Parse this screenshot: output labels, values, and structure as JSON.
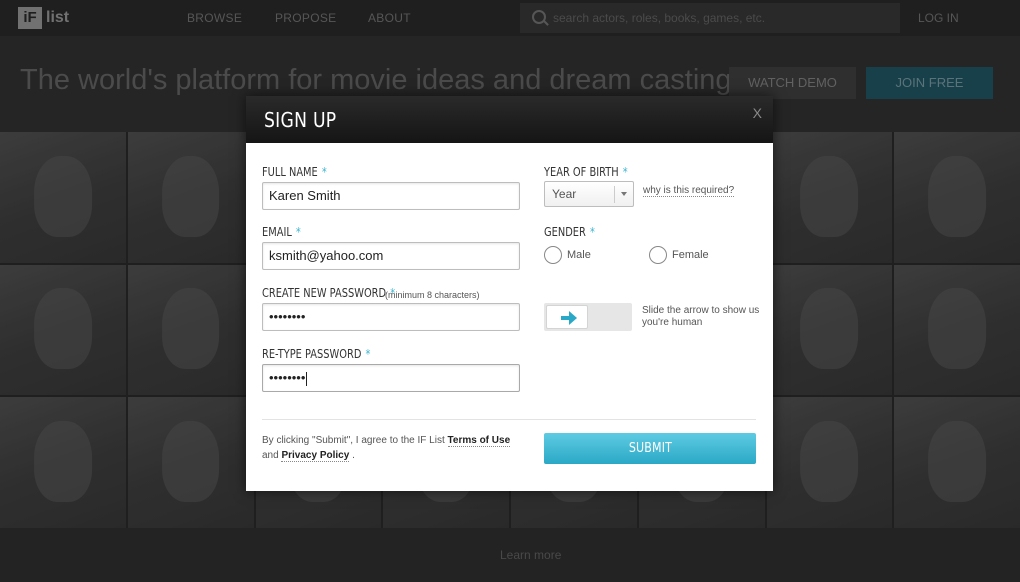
{
  "nav": {
    "logo_box": "iF",
    "logo_text": "list",
    "items": [
      "BROWSE",
      "PROPOSE",
      "ABOUT"
    ],
    "search_placeholder": "search actors, roles, books, games, etc.",
    "login": "LOG IN"
  },
  "hero": {
    "title": "The world's platform for movie ideas and dream casting",
    "watch_demo": "WATCH DEMO",
    "join_free": "JOIN FREE"
  },
  "footer": {
    "learn_more": "Learn more"
  },
  "modal": {
    "title": "SIGN UP",
    "close": "X",
    "required_mark": "*",
    "full_name": {
      "label": "FULL NAME",
      "value": "Karen Smith"
    },
    "email": {
      "label": "EMAIL",
      "value": "ksmith@yahoo.com"
    },
    "password": {
      "label": "CREATE NEW PASSWORD",
      "hint": "(minimum 8 characters)",
      "value": "••••••••"
    },
    "retype": {
      "label": "RE-TYPE PASSWORD",
      "value": "••••••••"
    },
    "year": {
      "label": "YEAR OF BIRTH",
      "selected": "Year",
      "why": "why is this required?"
    },
    "gender": {
      "label": "GENDER",
      "options": [
        "Male",
        "Female"
      ]
    },
    "captcha": {
      "text": "Slide the arrow to show us you're human"
    },
    "terms": {
      "prefix": "By clicking \"Submit\", I agree to the IF List",
      "terms_link": "Terms of Use",
      "middle": "and",
      "privacy_link": "Privacy Policy",
      "suffix": "."
    },
    "submit": "SUBMIT"
  },
  "colors": {
    "accent": "#3fb6d0",
    "submit_top": "#5fcbe3",
    "submit_bottom": "#2aa8c6"
  }
}
